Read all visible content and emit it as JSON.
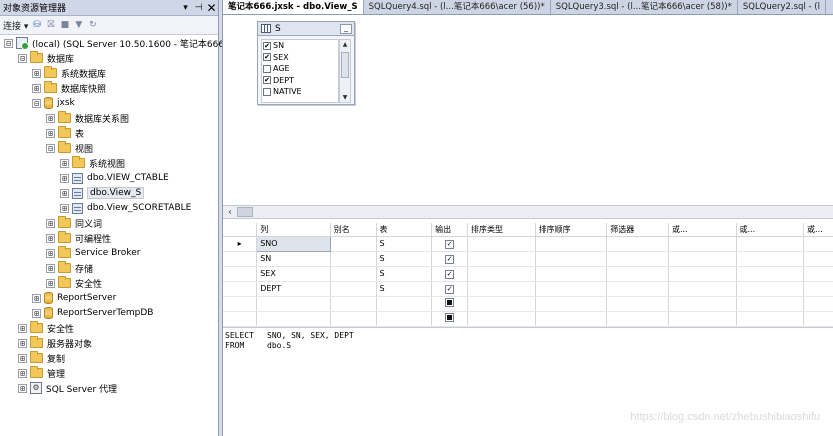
{
  "object_explorer": {
    "title": "对象资源管理器",
    "pin_glyph": "▾ ⊣",
    "close_glyph": "✕",
    "toolbar": {
      "connect_label": "连接 ▾"
    },
    "tree": [
      {
        "label": "(local) (SQL Server 10.50.1600 - 笔记本666\\",
        "icon": "server-icon",
        "expander": "⊟",
        "level": 0
      },
      {
        "label": "数据库",
        "icon": "folder-icon",
        "expander": "⊟",
        "level": 1
      },
      {
        "label": "系统数据库",
        "icon": "folder-icon",
        "expander": "⊞",
        "level": 2
      },
      {
        "label": "数据库快照",
        "icon": "folder-icon",
        "expander": "⊞",
        "level": 2
      },
      {
        "label": "jxsk",
        "icon": "database-icon",
        "expander": "⊟",
        "level": 2
      },
      {
        "label": "数据库关系图",
        "icon": "folder-icon",
        "expander": "⊞",
        "level": 3
      },
      {
        "label": "表",
        "icon": "folder-icon",
        "expander": "⊞",
        "level": 3
      },
      {
        "label": "视图",
        "icon": "folder-icon",
        "expander": "⊟",
        "level": 3
      },
      {
        "label": "系统视图",
        "icon": "folder-icon",
        "expander": "⊞",
        "level": 4
      },
      {
        "label": "dbo.VIEW_CTABLE",
        "icon": "view-icon",
        "expander": "⊞",
        "level": 4
      },
      {
        "label": "dbo.View_S",
        "icon": "view-icon",
        "expander": "⊞",
        "level": 4,
        "selected": true
      },
      {
        "label": "dbo.View_SCORETABLE",
        "icon": "view-icon",
        "expander": "⊞",
        "level": 4
      },
      {
        "label": "同义词",
        "icon": "folder-icon",
        "expander": "⊞",
        "level": 3
      },
      {
        "label": "可编程性",
        "icon": "folder-icon",
        "expander": "⊞",
        "level": 3
      },
      {
        "label": "Service Broker",
        "icon": "folder-icon",
        "expander": "⊞",
        "level": 3
      },
      {
        "label": "存储",
        "icon": "folder-icon",
        "expander": "⊞",
        "level": 3
      },
      {
        "label": "安全性",
        "icon": "folder-icon",
        "expander": "⊞",
        "level": 3
      },
      {
        "label": "ReportServer",
        "icon": "database-icon",
        "expander": "⊞",
        "level": 2
      },
      {
        "label": "ReportServerTempDB",
        "icon": "database-icon",
        "expander": "⊞",
        "level": 2
      },
      {
        "label": "安全性",
        "icon": "folder-icon",
        "expander": "⊞",
        "level": 1
      },
      {
        "label": "服务器对象",
        "icon": "folder-icon",
        "expander": "⊞",
        "level": 1
      },
      {
        "label": "复制",
        "icon": "folder-icon",
        "expander": "⊞",
        "level": 1
      },
      {
        "label": "管理",
        "icon": "folder-icon",
        "expander": "⊞",
        "level": 1
      },
      {
        "label": "SQL Server 代理",
        "icon": "agent-icon",
        "expander": "⊞",
        "level": 1
      }
    ]
  },
  "tabs": [
    {
      "label": "笔记本666.jxsk - dbo.View_S",
      "active": true
    },
    {
      "label": "SQLQuery4.sql - (l...笔记本666\\acer (56))*"
    },
    {
      "label": "SQLQuery3.sql - (l...笔记本666\\acer (58))*"
    },
    {
      "label": "SQLQuery2.sql - (l"
    }
  ],
  "diagram": {
    "table_name": "S",
    "min_glyph": "_",
    "columns": [
      {
        "name": "SN",
        "checked": true
      },
      {
        "name": "SEX",
        "checked": true
      },
      {
        "name": "AGE",
        "checked": false
      },
      {
        "name": "DEPT",
        "checked": true
      },
      {
        "name": "NATIVE",
        "checked": false
      }
    ]
  },
  "criteria_grid": {
    "headers": [
      "列",
      "别名",
      "表",
      "输出",
      "排序类型",
      "排序顺序",
      "筛选器",
      "或...",
      "或...",
      "或..."
    ],
    "current_row_marker": "▸",
    "rows": [
      {
        "column": "SNO",
        "alias": "",
        "table": "S",
        "output": "checked"
      },
      {
        "column": "SN",
        "alias": "",
        "table": "S",
        "output": "checked"
      },
      {
        "column": "SEX",
        "alias": "",
        "table": "S",
        "output": "checked"
      },
      {
        "column": "DEPT",
        "alias": "",
        "table": "S",
        "output": "checked"
      },
      {
        "column": "",
        "alias": "",
        "table": "",
        "output": "filled"
      },
      {
        "column": "",
        "alias": "",
        "table": "",
        "output": "filled"
      }
    ]
  },
  "sql_pane": {
    "lines": [
      {
        "keyword": "SELECT",
        "text": "SNO, SN, SEX, DEPT"
      },
      {
        "keyword": "FROM",
        "text": "dbo.S"
      }
    ]
  },
  "watermark": "https://blog.csdn.net/zhebushibiaoshifu"
}
